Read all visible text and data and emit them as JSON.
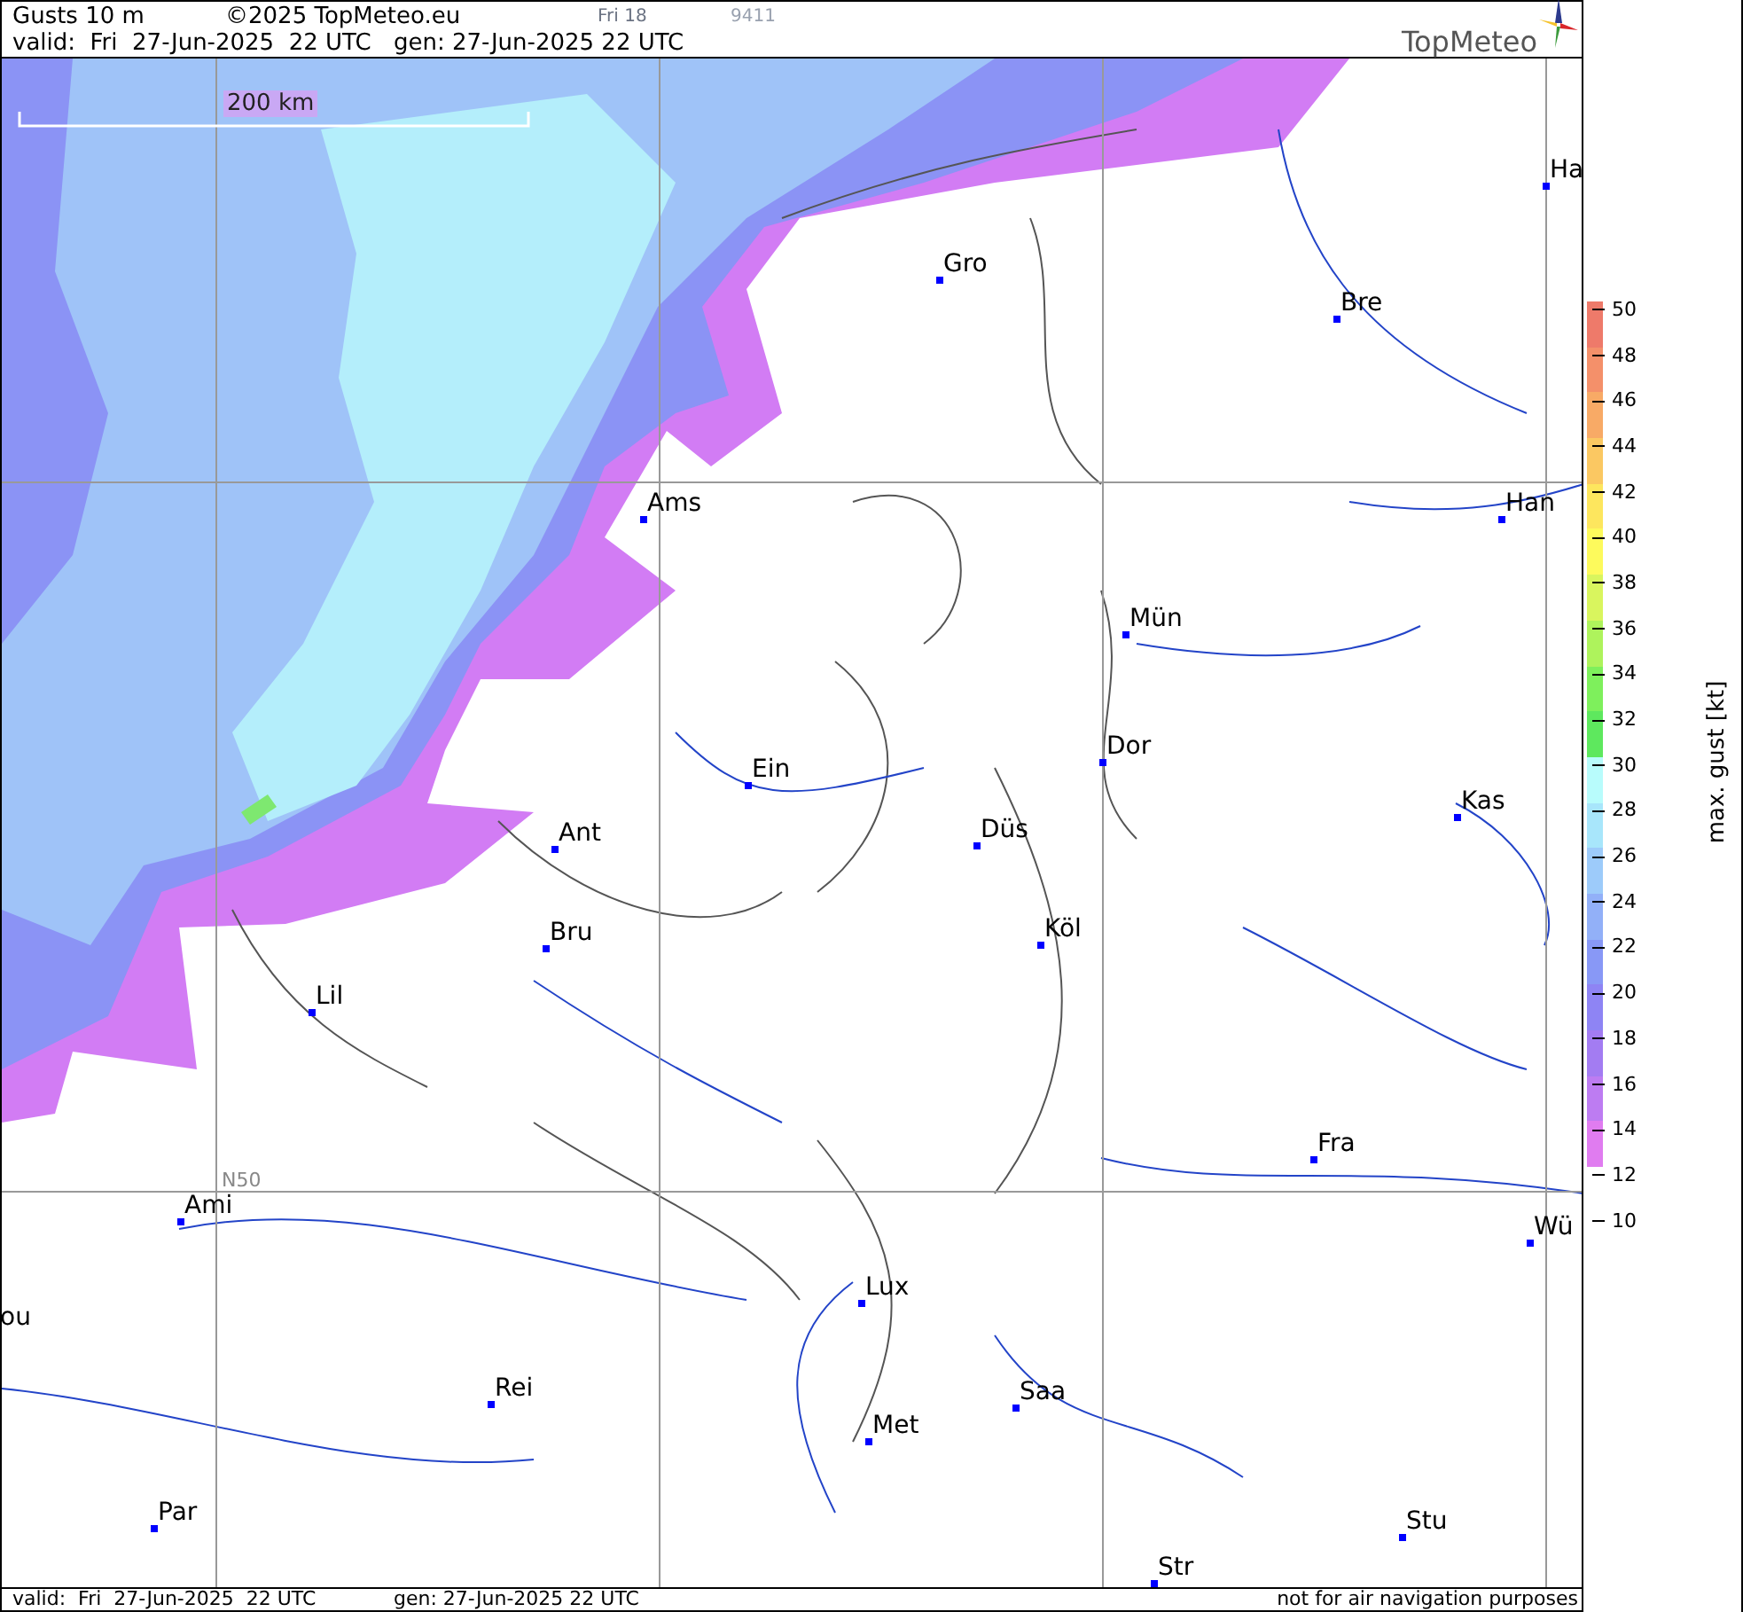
{
  "header": {
    "title": "Gusts 10 m",
    "copyright": "©2025 TopMeteo.eu",
    "frame": "Fri 18",
    "code": "9411",
    "valid": "valid:  Fri  27-Jun-2025  22 UTC",
    "generated": "gen: 27-Jun-2025 22 UTC",
    "logo": "TopMeteo"
  },
  "map": {
    "scale": "200 km",
    "grid_label": "N50",
    "cities": [
      "Ha",
      "Gro",
      "Bre",
      "Ams",
      "Han",
      "Mün",
      "Dor",
      "Ein",
      "Kas",
      "Düs",
      "Ant",
      "Köl",
      "Bru",
      "Lil",
      "Fra",
      "Ami",
      "Wü",
      "Lux",
      "ou",
      "Rei",
      "Saa",
      "Met",
      "Par",
      "Stu",
      "Str"
    ]
  },
  "legend": {
    "title": "max. gust [kt]",
    "ticks": [
      "50",
      "48",
      "46",
      "44",
      "42",
      "40",
      "38",
      "36",
      "34",
      "32",
      "30",
      "28",
      "26",
      "24",
      "22",
      "20",
      "18",
      "16",
      "14",
      "12",
      "10"
    ]
  },
  "footer": {
    "valid": "valid:  Fri  27-Jun-2025  22 UTC",
    "generated": "gen: 27-Jun-2025 22 UTC",
    "note": "not for air navigation purposes"
  }
}
